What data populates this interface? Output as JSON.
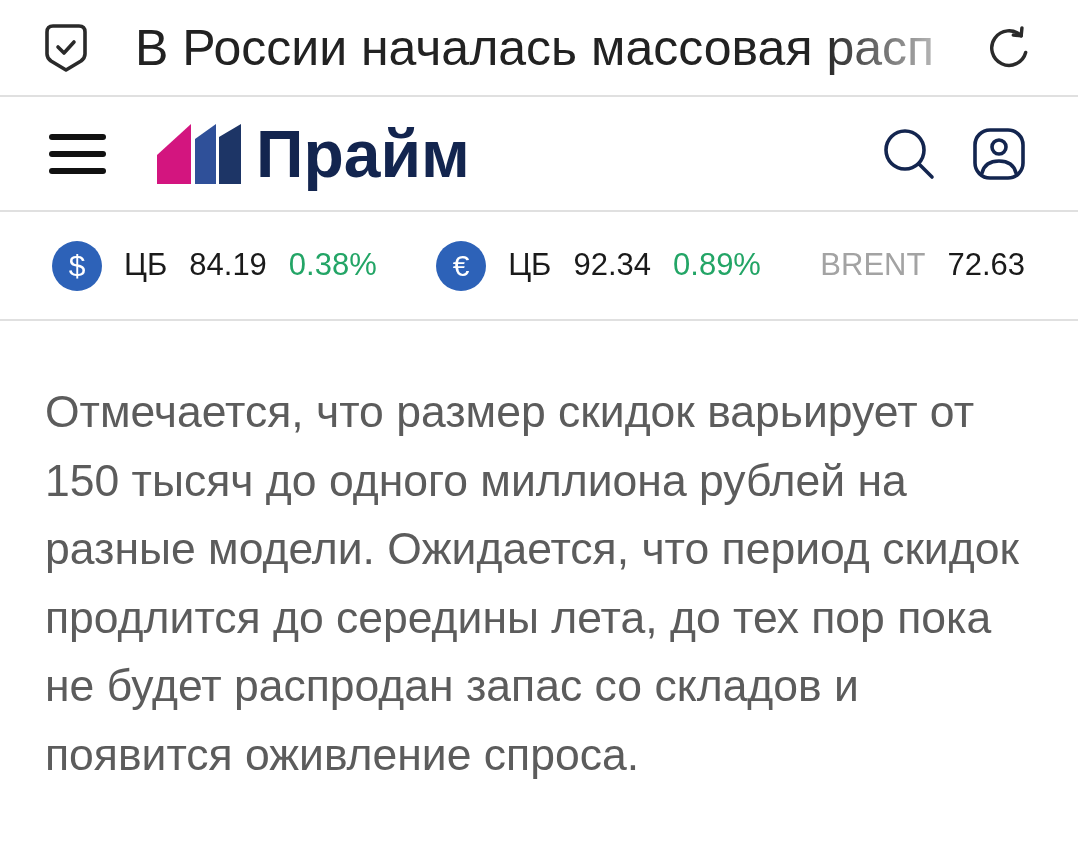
{
  "browser_bar": {
    "title": "В России началась массовая расп"
  },
  "header": {
    "logo_text": "Прайм"
  },
  "ticker": [
    {
      "kind": "currency",
      "symbol": "$",
      "source": "ЦБ",
      "value": "84.19",
      "change": "0.38%",
      "rising": true
    },
    {
      "kind": "currency",
      "symbol": "€",
      "source": "ЦБ",
      "value": "92.34",
      "change": "0.89%",
      "rising": true
    },
    {
      "kind": "commodity",
      "name": "BRENT",
      "value": "72.63"
    }
  ],
  "article": {
    "paragraph": "Отмечается, что размер скидок варьирует от 150 тысяч до одного миллиона рублей на разные модели. Ожидается, что период скидок продлится до середины лета, до тех пор пока не будет распродан запас со складов и появится оживление спроса."
  }
}
